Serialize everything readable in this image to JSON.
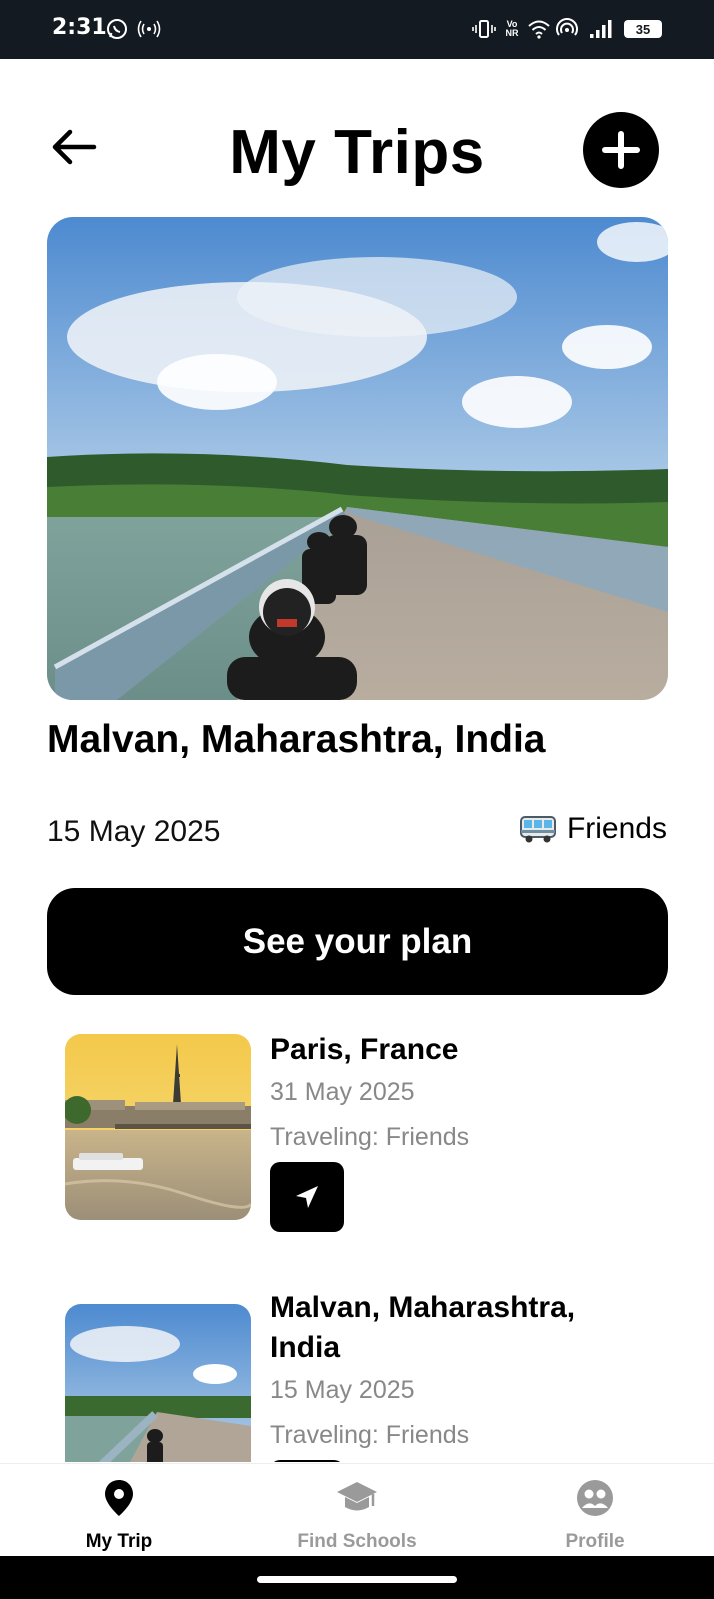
{
  "status_bar": {
    "time": "2:31",
    "battery": "35",
    "network_label": "Vo NR"
  },
  "header": {
    "title": "My Trips"
  },
  "current_trip": {
    "name": "Malvan, Maharashtra, India",
    "date": "15 May 2025",
    "companion": "Friends",
    "companion_icon": "bus-icon",
    "button_label": "See your plan"
  },
  "trips": [
    {
      "name": "Paris, France",
      "date": "31 May 2025",
      "traveling": "Traveling: Friends"
    },
    {
      "name": "Malvan, Maharashtra, India",
      "date": "15 May 2025",
      "traveling": "Traveling: Friends"
    }
  ],
  "bottom_nav": [
    {
      "label": "My Trip",
      "icon": "location-pin-icon",
      "active": true
    },
    {
      "label": "Find Schools",
      "icon": "graduation-cap-icon",
      "active": false
    },
    {
      "label": "Profile",
      "icon": "profile-icon",
      "active": false
    }
  ],
  "colors": {
    "primary": "#000000",
    "muted_text": "#888888",
    "inactive_nav": "#9a9a9a",
    "status_bar": "#141a21"
  }
}
